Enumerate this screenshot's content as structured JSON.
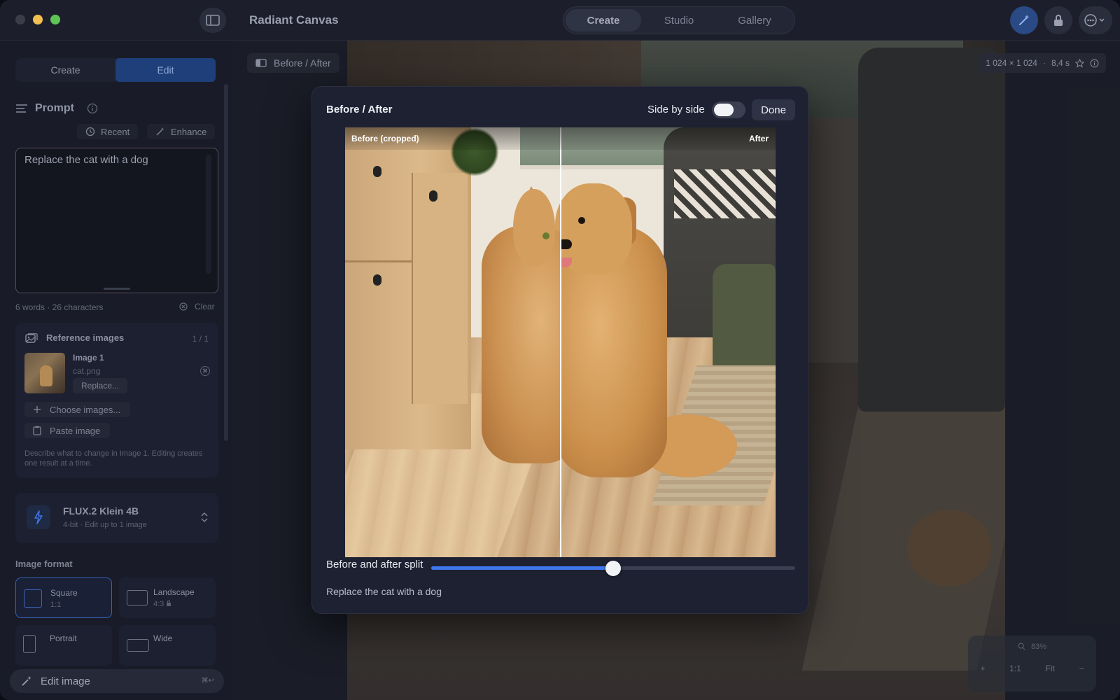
{
  "window": {
    "title": "Radiant Canvas",
    "modes": [
      "Create",
      "Studio",
      "Gallery"
    ],
    "active_mode": "Create"
  },
  "sidebar": {
    "tabs": [
      "Create",
      "Edit"
    ],
    "active_tab": "Edit",
    "prompt": {
      "title": "Prompt",
      "recent_label": "Recent",
      "enhance_label": "Enhance",
      "text": "Replace the cat with a dog",
      "counts": "6 words · 26 characters",
      "clear_label": "Clear"
    },
    "reference_images": {
      "title": "Reference images",
      "count": "1 / 1",
      "image_name": "Image 1",
      "image_file": "cat.png",
      "replace_label": "Replace...",
      "choose_label": "Choose images...",
      "paste_label": "Paste image",
      "hint": "Describe what to change in Image 1. Editing creates one result at a time."
    },
    "model": {
      "name": "FLUX.2 Klein 4B",
      "subtitle": "4-bit · Edit up to 1 image"
    },
    "image_format": {
      "title": "Image format",
      "options": [
        {
          "name": "Square",
          "ratio": "1:1"
        },
        {
          "name": "Landscape",
          "ratio": "4:3"
        },
        {
          "name": "Portrait",
          "ratio": ""
        },
        {
          "name": "Wide",
          "ratio": ""
        }
      ],
      "selected": "Square"
    },
    "edit_button": "Edit image",
    "edit_shortcut": "⌘↩"
  },
  "canvas": {
    "before_after_chip": "Before / After",
    "meta": {
      "dimensions": "1 024 × 1 024",
      "time": "8,4 s"
    },
    "zoom": {
      "percent": "83%",
      "one_to_one": "1:1",
      "fit": "Fit",
      "plus": "+",
      "minus": "−"
    }
  },
  "dialog": {
    "title": "Before / After",
    "side_by_side_label": "Side by side",
    "side_by_side_on": false,
    "done_label": "Done",
    "before_label": "Before (cropped)",
    "after_label": "After",
    "split_label": "Before and after split",
    "split_value": 0.5,
    "caption": "Replace the cat with a dog"
  },
  "colors": {
    "accent": "#3e77ee",
    "window_bg": "#1a1d29",
    "dialog_bg": "#1e2131"
  }
}
